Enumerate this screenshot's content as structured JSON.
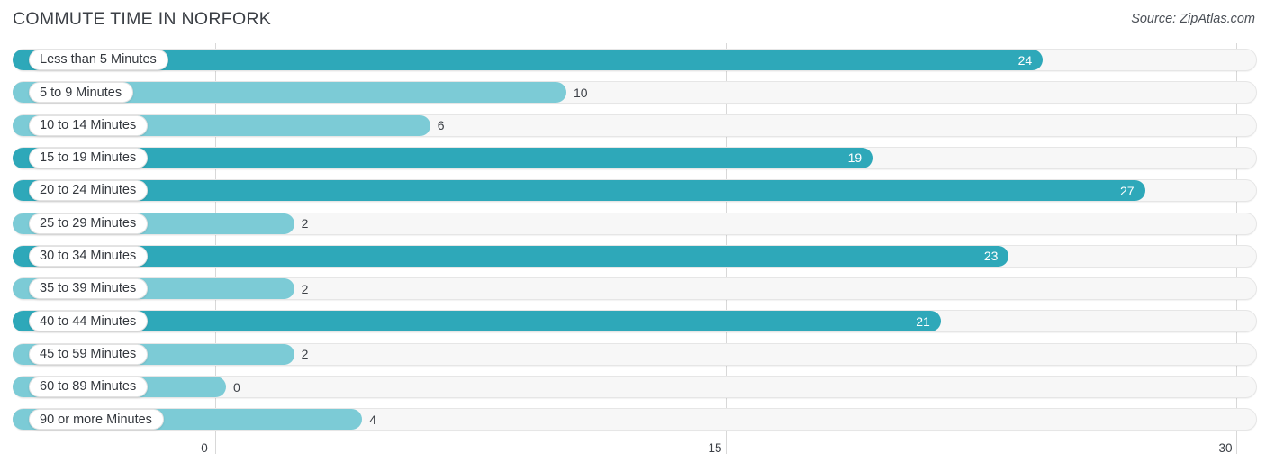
{
  "header": {
    "title": "COMMUTE TIME IN NORFORK",
    "source": "Source: ZipAtlas.com"
  },
  "colors": {
    "bar_high": "#2ea8b9",
    "bar_low": "#7ccbd6",
    "track": "#f7f7f7",
    "track_border": "#e6e6e6",
    "gridline": "#d8d8d8",
    "text": "#33373d",
    "value_inside": "#ffffff"
  },
  "chart_data": {
    "type": "bar",
    "orientation": "horizontal",
    "title": "COMMUTE TIME IN NORFORK",
    "xlabel": "",
    "ylabel": "",
    "xlim": [
      0,
      30
    ],
    "ticks": [
      0,
      15,
      30
    ],
    "tick_labels": [
      "0",
      "15",
      "30"
    ],
    "grid": true,
    "legend": false,
    "categories": [
      "Less than 5 Minutes",
      "5 to 9 Minutes",
      "10 to 14 Minutes",
      "15 to 19 Minutes",
      "20 to 24 Minutes",
      "25 to 29 Minutes",
      "30 to 34 Minutes",
      "35 to 39 Minutes",
      "40 to 44 Minutes",
      "45 to 59 Minutes",
      "60 to 89 Minutes",
      "90 or more Minutes"
    ],
    "values": [
      24,
      10,
      6,
      19,
      27,
      2,
      23,
      2,
      21,
      2,
      0,
      4
    ],
    "value_labels": [
      "24",
      "10",
      "6",
      "19",
      "27",
      "2",
      "23",
      "2",
      "21",
      "2",
      "0",
      "4"
    ]
  }
}
